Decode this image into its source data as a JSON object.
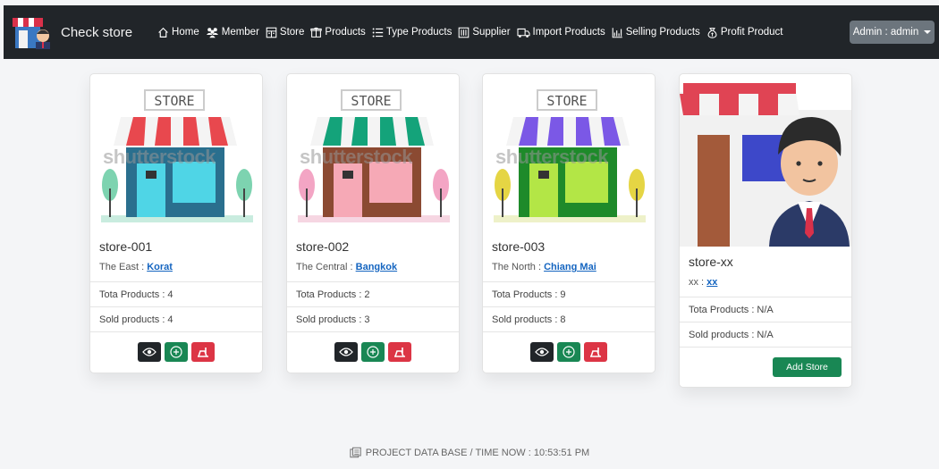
{
  "brand": {
    "title": "Check store"
  },
  "nav": [
    {
      "label": "Home",
      "icon": "home-icon"
    },
    {
      "label": "Member",
      "icon": "people-icon"
    },
    {
      "label": "Store",
      "icon": "store-icon"
    },
    {
      "label": "Products",
      "icon": "box-icon"
    },
    {
      "label": "Type Products",
      "icon": "list-icon"
    },
    {
      "label": "Supplier",
      "icon": "building-icon"
    },
    {
      "label": "Import Products",
      "icon": "truck-icon"
    },
    {
      "label": "Selling Products",
      "icon": "chart-icon"
    },
    {
      "label": "Profit Product",
      "icon": "moneybag-icon"
    }
  ],
  "user": {
    "label": "Admin : admin"
  },
  "stores": [
    {
      "name": "store-001",
      "region_prefix": "The East : ",
      "region_link": "Korat",
      "total": "Tota Products : 4",
      "sold": "Sold products : 4",
      "sign": "STORE",
      "awning": "#e8484e",
      "wall": "#2a6f8e",
      "window": "#4fd5e6",
      "tree": "#7dd3b0",
      "ground": "#c9ecdf",
      "watermark": "shutterstock"
    },
    {
      "name": "store-002",
      "region_prefix": "The Central : ",
      "region_link": "Bangkok",
      "total": "Tota Products : 2",
      "sold": "Sold products : 3",
      "sign": "STORE",
      "awning": "#14a37a",
      "wall": "#8b4a32",
      "window": "#f6a9b6",
      "tree": "#f3a5c4",
      "ground": "#f6d6e2",
      "watermark": "shutterstock"
    },
    {
      "name": "store-003",
      "region_prefix": "The North : ",
      "region_link": "Chiang Mai",
      "total": "Tota Products : 9",
      "sold": "Sold products : 8",
      "sign": "STORE",
      "awning": "#7b58e6",
      "wall": "#1e8a2a",
      "window": "#b3e646",
      "tree": "#e5d544",
      "ground": "#eef1c9",
      "watermark": "shutterstock"
    }
  ],
  "placeholder_store": {
    "name": "store-xx",
    "region_prefix": "xx : ",
    "region_link": "xx",
    "total": "Tota Products : N/A",
    "sold": "Sold products : N/A",
    "add_label": "Add Store"
  },
  "footer": {
    "text": "PROJECT DATA BASE / TIME NOW : 10:53:51 PM"
  }
}
